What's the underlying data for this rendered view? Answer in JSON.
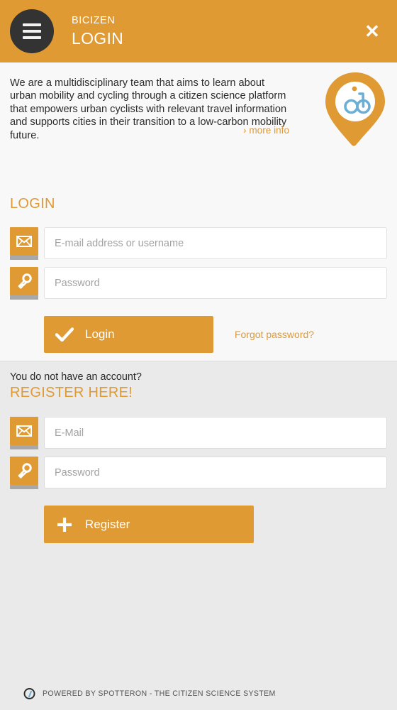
{
  "header": {
    "menu_icon": "hamburger-menu-icon",
    "app_name": "BICIZEN",
    "page_title": "LOGIN",
    "close_icon": "close-icon",
    "background_color": "#E09A34",
    "menu_button_color": "#333333"
  },
  "info": {
    "description": "We are a multidisciplinary team that aims to learn about urban mobility and cycling through a citizen science platform that empowers urban cyclists with relevant travel information and supports cities in their transition to a low-carbon mobility future.",
    "more_info_link": "› more info",
    "logo_icon": "bicycle-map-pin-logo",
    "logo_ring_color": "#E09A34",
    "logo_bike_color": "#6BAFD6"
  },
  "login": {
    "heading": "LOGIN",
    "fields": [
      {
        "icon": "envelope-icon",
        "placeholder": "E-mail address or username",
        "value": "",
        "type": "text"
      },
      {
        "icon": "key-icon",
        "placeholder": "Password",
        "value": "",
        "type": "password"
      }
    ],
    "submit_label": "Login",
    "submit_icon": "checkmark-icon",
    "forgot_password_label": "Forgot password?",
    "accent_color": "#E09A34",
    "background_color": "#F8F8F8"
  },
  "register": {
    "prompt": "You do not have an account?",
    "heading": "REGISTER HERE!",
    "fields": [
      {
        "icon": "envelope-icon",
        "placeholder": "E-Mail",
        "value": "",
        "type": "text"
      },
      {
        "icon": "key-icon",
        "placeholder": "Password",
        "value": "",
        "type": "password"
      }
    ],
    "submit_label": "Register",
    "submit_icon": "plus-icon",
    "background_color": "#EAEAEA"
  },
  "footer": {
    "logo_icon": "spotteron-pin-icon",
    "text": "POWERED BY SPOTTERON - THE CITIZEN SCIENCE SYSTEM"
  }
}
